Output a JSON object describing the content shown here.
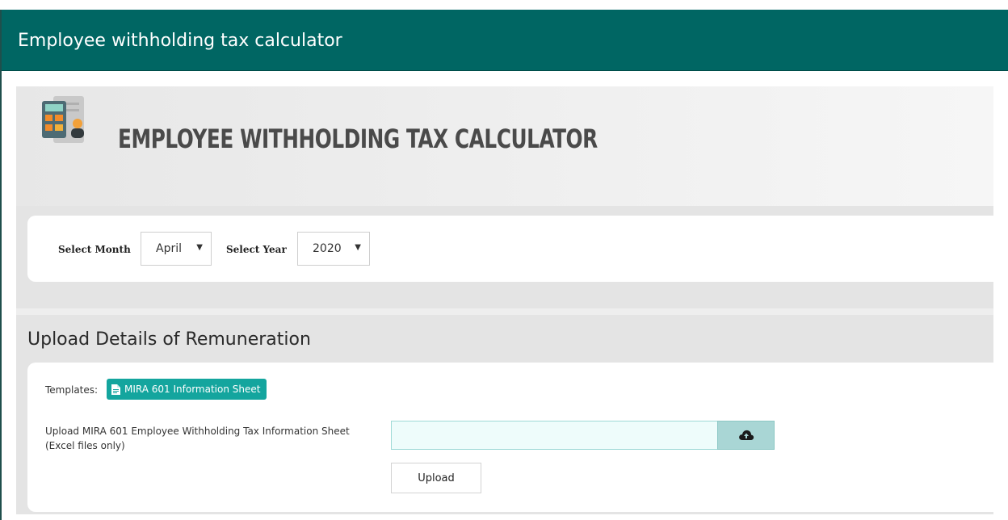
{
  "window": {
    "title": "Employee withholding tax calculator"
  },
  "hero": {
    "heading": "EMPLOYEE WITHHOLDING TAX CALCULATOR",
    "logo_icon": "calculator-icon"
  },
  "period": {
    "month_label": "Select Month",
    "month_value": "April",
    "year_label": "Select Year",
    "year_value": "2020"
  },
  "upload": {
    "section_title": "Upload Details of Remuneration",
    "templates_label": "Templates:",
    "template_link": "MIRA 601 Information Sheet",
    "file_label": "Upload MIRA 601 Employee Withholding Tax Information Sheet (Excel files only)",
    "file_value": "",
    "upload_button": "Upload"
  },
  "colors": {
    "title_bar": "#006663",
    "accent": "#14a59e",
    "file_input_bg": "#eefcfb",
    "cloud_button_bg": "#a9d6d5"
  }
}
